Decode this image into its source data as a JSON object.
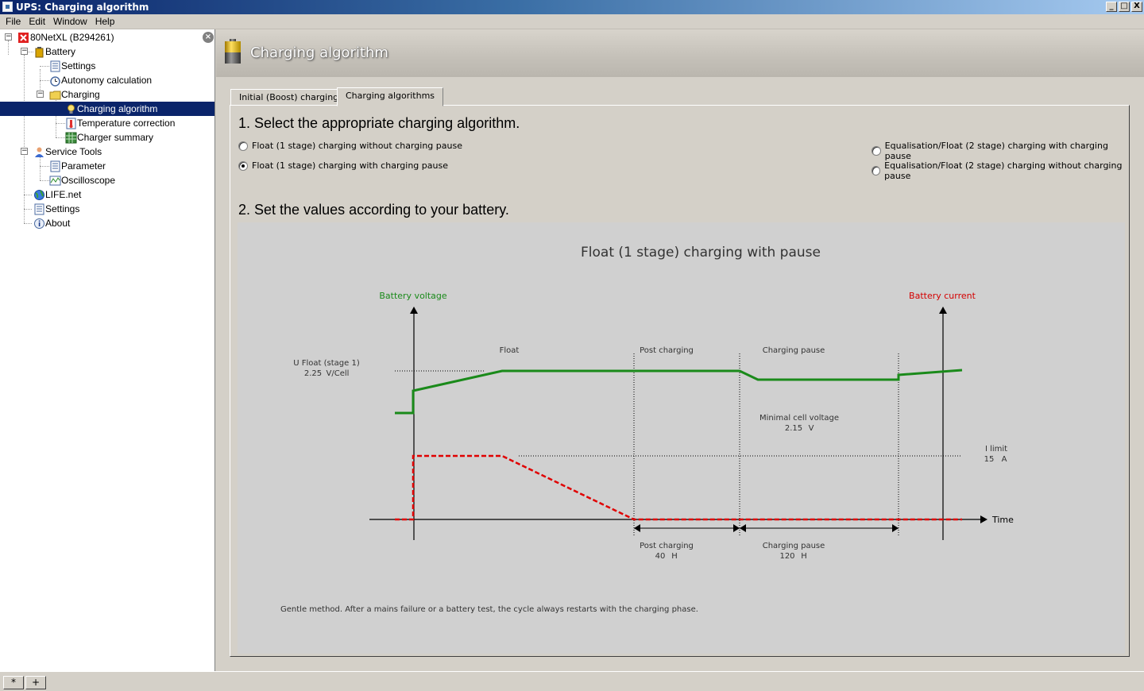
{
  "window": {
    "title": "UPS: Charging algorithm",
    "controls": [
      "_",
      "□",
      "X"
    ]
  },
  "menu": [
    "File",
    "Edit",
    "Window",
    "Help"
  ],
  "tree": {
    "root": "80NetXL (B294261)",
    "items": {
      "battery": "Battery",
      "settings": "Settings",
      "autonomy": "Autonomy calculation",
      "charging": "Charging",
      "charging_algorithm": "Charging algorithm",
      "temperature": "Temperature correction",
      "charger_summary": "Charger summary",
      "service_tools": "Service Tools",
      "parameter": "Parameter",
      "oscilloscope": "Oscilloscope",
      "lifenet": "LIFE.net",
      "settings2": "Settings",
      "about": "About"
    },
    "close_glyph": "×"
  },
  "page": {
    "title": "Charging algorithm"
  },
  "tabs": {
    "initial": "Initial (Boost) charging",
    "algorithms": "Charging algorithms"
  },
  "section1": {
    "heading": "1. Select the appropriate charging algorithm.",
    "options": {
      "float_no_pause": "Float (1 stage) charging without charging pause",
      "float_pause": "Float (1 stage) charging with charging pause",
      "eq_pause": "Equalisation/Float (2 stage) charging with charging pause",
      "eq_no_pause": "Equalisation/Float (2 stage) charging without charging pause"
    },
    "selected": "float_pause"
  },
  "section2": {
    "heading": "2. Set the values according to your battery."
  },
  "diagram": {
    "title": "Float (1 stage) charging with pause",
    "battery_voltage": "Battery voltage",
    "battery_current": "Battery current",
    "time": "Time",
    "phase_float": "Float",
    "phase_post": "Post charging",
    "phase_pause": "Charging pause",
    "u_float_label": "U Float (stage 1)",
    "u_float_value": "2.25",
    "u_float_unit": "V/Cell",
    "min_cell_label": "Minimal cell voltage",
    "min_cell_value": "2.15",
    "min_cell_unit": "V",
    "i_limit_label": "I limit",
    "i_limit_value": "15",
    "i_limit_unit": "A",
    "post_label": "Post charging",
    "post_value": "40",
    "post_unit": "H",
    "pause_label": "Charging pause",
    "pause_value": "120",
    "pause_unit": "H",
    "note": "Gentle method. After a mains failure or a battery test, the cycle always restarts with the charging phase.",
    "colors": {
      "voltage": "#1a8a1a",
      "current": "#e00000",
      "voltage_label": "#1a8a1a",
      "current_label": "#d40000"
    }
  },
  "bottom": {
    "tab1": "*",
    "tab2": "+"
  }
}
